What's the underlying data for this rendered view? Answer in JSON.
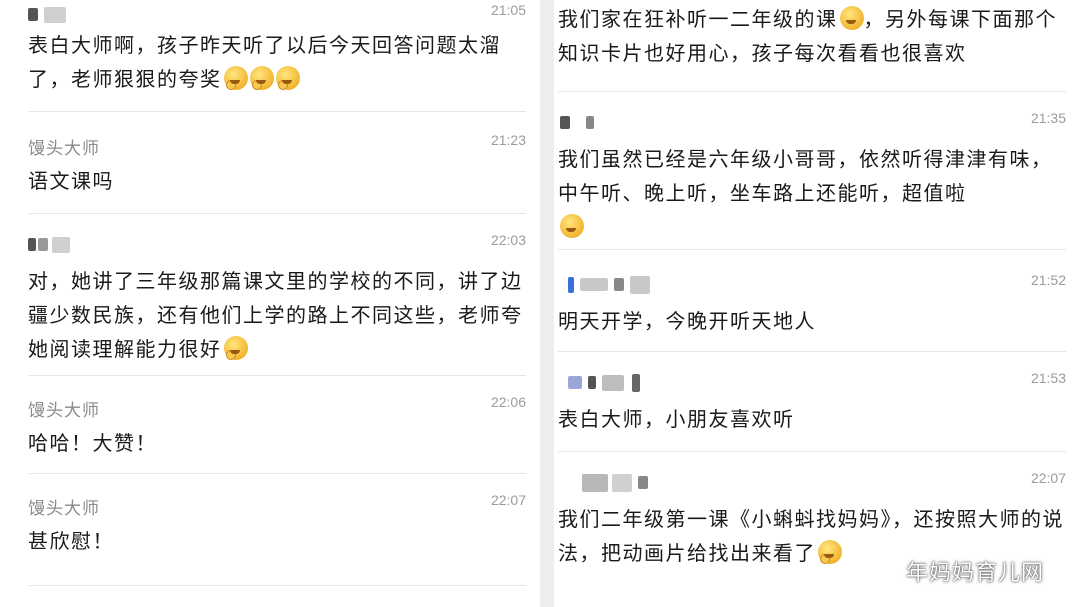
{
  "left": {
    "messages": [
      {
        "name": "",
        "time": "21:05",
        "text": "表白大师啊，孩子昨天听了以后今天回答问题太溜了，老师狠狠的夸奖",
        "emoji": [
          "think",
          "think",
          "think"
        ]
      },
      {
        "name": "馒头大师",
        "time": "21:23",
        "text": "语文课吗"
      },
      {
        "name": "",
        "time": "22:03",
        "text": "对，她讲了三年级那篇课文里的学校的不同，讲了边疆少数民族，还有他们上学的路上不同这些，老师夸她阅读理解能力很好",
        "emoji": [
          "think"
        ]
      },
      {
        "name": "馒头大师",
        "time": "22:06",
        "text": "哈哈！大赞！"
      },
      {
        "name": "馒头大师",
        "time": "22:07",
        "text": "甚欣慰！"
      }
    ]
  },
  "right": {
    "messages": [
      {
        "name": "",
        "time": "",
        "text": "我们家在狂补听一二年级的课",
        "text_after": "，另外每课下面那个知识卡片也好用心，孩子每次看看也很喜欢",
        "emoji_inline": "laugh"
      },
      {
        "name": "",
        "time": "21:35",
        "text": "我们虽然已经是六年级小哥哥，依然听得津津有味，中午听、晚上听，坐车路上还能听，超值啦",
        "emoji": [
          "666"
        ]
      },
      {
        "name": "",
        "time": "21:52",
        "text": "明天开学，今晚开听天地人"
      },
      {
        "name": "",
        "time": "21:53",
        "text": "表白大师，小朋友喜欢听"
      },
      {
        "name": "",
        "time": "22:07",
        "text": "我们二年级第一课《小蝌蚪找妈妈》，还按照大师的说法，把动画片给找出来看了",
        "emoji": [
          "think"
        ]
      }
    ]
  },
  "watermark": {
    "text": "年妈妈育儿网",
    "icon": "wechat-icon"
  },
  "colors": {
    "text": "#1a1a1a",
    "meta": "#9b9b9b",
    "name": "#8a8a8a",
    "divider": "#e6e6e6",
    "gap": "#ededed"
  }
}
